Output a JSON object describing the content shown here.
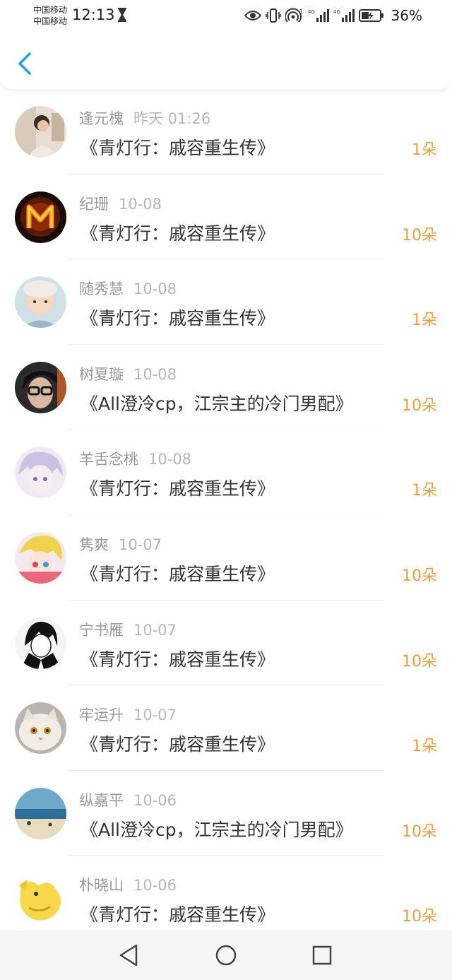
{
  "status": {
    "carrier1": "中国移动",
    "carrier2": "中国移动",
    "time": "12:13",
    "battery": "36%"
  },
  "colors": {
    "accent": "#1e9ff2",
    "flower": "#f39a3a"
  },
  "list": [
    {
      "name": "逢元槐",
      "date": "昨天 01:26",
      "book": "《青灯行：戚容重生传》",
      "count": "1朵",
      "avatar": "portrait-photo"
    },
    {
      "name": "纪珊",
      "date": "10-08",
      "book": "《青灯行：戚容重生传》",
      "count": "10朵",
      "avatar": "fire-letter-m"
    },
    {
      "name": "随秀慧",
      "date": "10-08",
      "book": "《青灯行：戚容重生传》",
      "count": "1朵",
      "avatar": "baby-photo"
    },
    {
      "name": "树夏璇",
      "date": "10-08",
      "book": "《All澄冷cp，江宗主的冷门男配》",
      "count": "10朵",
      "avatar": "glasses-man"
    },
    {
      "name": "羊舌念桃",
      "date": "10-08",
      "book": "《青灯行：戚容重生传》",
      "count": "1朵",
      "avatar": "anime-purple"
    },
    {
      "name": "隽爽",
      "date": "10-07",
      "book": "《青灯行：戚容重生传》",
      "count": "10朵",
      "avatar": "anime-colorful"
    },
    {
      "name": "宁书雁",
      "date": "10-07",
      "book": "《青灯行：戚容重生传》",
      "count": "10朵",
      "avatar": "manga-bw"
    },
    {
      "name": "牢运升",
      "date": "10-07",
      "book": "《青灯行：戚容重生传》",
      "count": "1朵",
      "avatar": "cat-photo"
    },
    {
      "name": "纵嘉平",
      "date": "10-06",
      "book": "《All澄冷cp，江宗主的冷门男配》",
      "count": "10朵",
      "avatar": "beach-photo"
    },
    {
      "name": "朴晓山",
      "date": "10-06",
      "book": "《青灯行：戚容重生传》",
      "count": "10朵",
      "avatar": "yellow-cartoon"
    }
  ]
}
